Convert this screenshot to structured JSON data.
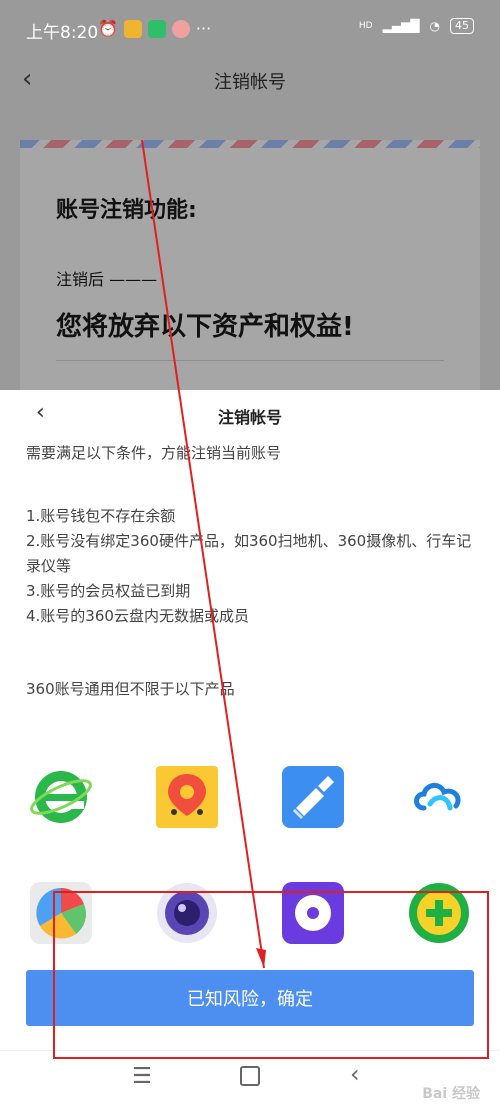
{
  "status_bar": {
    "time": "上午8:20",
    "signal": "HD",
    "battery": "45"
  },
  "background": {
    "nav_title": "注销帐号",
    "card_heading": "账号注销功能:",
    "card_sub": "注销后 ———",
    "card_line": "您将放弃以下资产和权益!"
  },
  "sheet": {
    "title": "注销帐号",
    "requirement": "需要满足以下条件，方能注销当前账号",
    "conditions": [
      "1.账号钱包不存在余额",
      "2.账号没有绑定360硬件产品，如360扫地机、360摄像机、行车记录仪等",
      "3.账号的会员权益已到期",
      "4.账号的360云盘内无数据或成员"
    ],
    "products_note": "360账号通用但不限于以下产品",
    "apps": [
      {
        "icon": "browser-e-icon"
      },
      {
        "icon": "map-pin-icon"
      },
      {
        "icon": "broom-icon"
      },
      {
        "icon": "cloud-icon"
      },
      {
        "icon": "pinwheel-icon"
      },
      {
        "icon": "camera-icon"
      },
      {
        "icon": "disc-icon"
      },
      {
        "icon": "security-plus-icon"
      }
    ],
    "confirm_label": "已知风险，确定"
  },
  "watermark": "Bai 经验",
  "annotation_color": "#e02020",
  "accent_color": "#4c8ff0"
}
